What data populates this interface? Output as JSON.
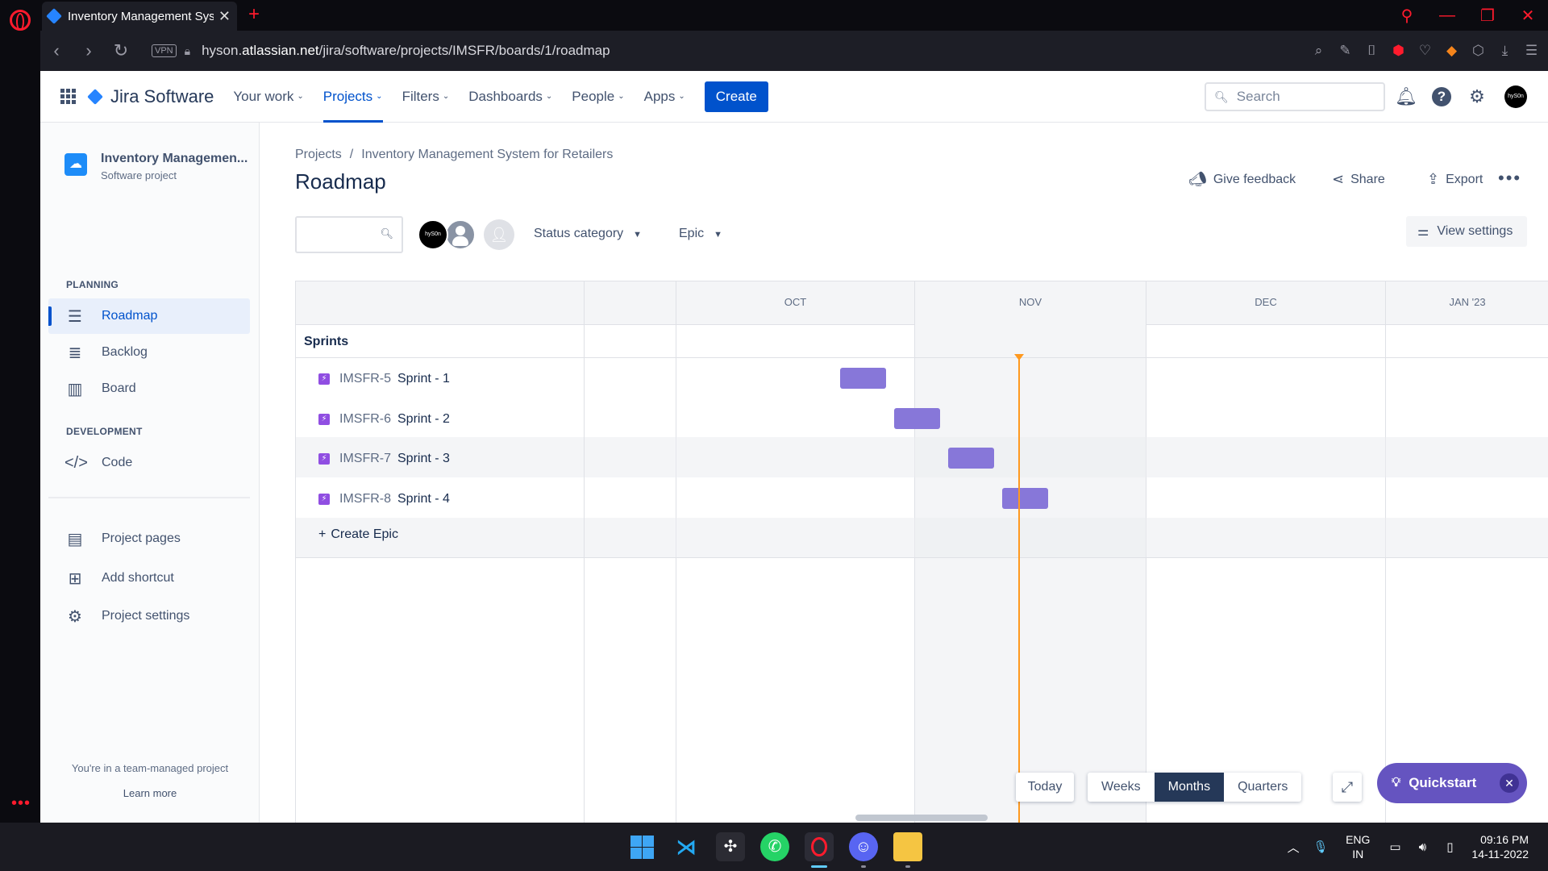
{
  "browser": {
    "tab_title": "Inventory Management Sys",
    "url_prefix": "hyson.",
    "url_host": "atlassian.net",
    "url_path": "/jira/software/projects/IMSFR/boards/1/roadmap",
    "vpn_label": "VPN"
  },
  "header": {
    "product": "Jira Software",
    "nav": [
      {
        "label": "Your work"
      },
      {
        "label": "Projects"
      },
      {
        "label": "Filters"
      },
      {
        "label": "Dashboards"
      },
      {
        "label": "People"
      },
      {
        "label": "Apps"
      }
    ],
    "create_label": "Create",
    "search_placeholder": "Search",
    "avatar_text": "hyS0n"
  },
  "sidebar": {
    "project_name": "Inventory Managemen...",
    "project_type": "Software project",
    "planning_heading": "PLANNING",
    "development_heading": "DEVELOPMENT",
    "items": [
      {
        "label": "Roadmap"
      },
      {
        "label": "Backlog"
      },
      {
        "label": "Board"
      },
      {
        "label": "Code"
      },
      {
        "label": "Project pages"
      },
      {
        "label": "Add shortcut"
      },
      {
        "label": "Project settings"
      }
    ],
    "team_managed_text": "You're in a team-managed project",
    "learn_more": "Learn more"
  },
  "main": {
    "breadcrumb": [
      "Projects",
      "Inventory Management System for Retailers"
    ],
    "title": "Roadmap",
    "actions": {
      "feedback": "Give feedback",
      "share": "Share",
      "export": "Export"
    },
    "filters": {
      "status": "Status category",
      "epic": "Epic"
    },
    "view_settings": "View settings",
    "member_avatar_text": "hyS0n"
  },
  "roadmap": {
    "months": [
      "OCT",
      "NOV",
      "DEC",
      "JAN '23"
    ],
    "group_label": "Sprints",
    "epics": [
      {
        "key": "IMSFR-5",
        "summary": "Sprint - 1"
      },
      {
        "key": "IMSFR-6",
        "summary": "Sprint - 2"
      },
      {
        "key": "IMSFR-7",
        "summary": "Sprint - 3"
      },
      {
        "key": "IMSFR-8",
        "summary": "Sprint - 4"
      }
    ],
    "create_epic": "Create Epic",
    "bar_color": "#8777d9",
    "today_color": "#ff991f"
  },
  "controls": {
    "today": "Today",
    "zoom": [
      "Weeks",
      "Months",
      "Quarters"
    ],
    "zoom_selected": "Months",
    "quickstart": "Quickstart"
  },
  "taskbar": {
    "lang_line1": "ENG",
    "lang_line2": "IN",
    "time": "09:16 PM",
    "date": "14-11-2022"
  }
}
